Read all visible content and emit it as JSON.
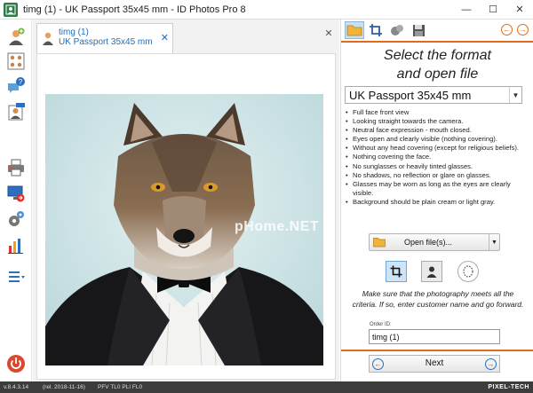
{
  "window": {
    "title": "timg (1) - UK Passport 35x45 mm - ID Photos Pro 8",
    "app_icon": "photo-id-icon",
    "controls": {
      "minimize": "—",
      "maximize": "☐",
      "close": "✕"
    }
  },
  "sidebar": {
    "items": [
      {
        "icon": "add-person-icon"
      },
      {
        "icon": "id-card-sheet-icon"
      },
      {
        "icon": "help-chat-icon"
      },
      {
        "icon": "new-id-photo-icon"
      },
      {
        "icon": "printer-icon"
      },
      {
        "icon": "export-screen-icon"
      },
      {
        "icon": "settings-gear-icon"
      },
      {
        "icon": "statistics-chart-icon"
      },
      {
        "icon": "menu-list-icon"
      },
      {
        "icon": "power-exit-icon"
      }
    ]
  },
  "document": {
    "tab": {
      "line1": "timg (1)",
      "line2": "UK Passport 35x45 mm",
      "close": "✕"
    },
    "close_all": "✕",
    "watermark": "pHome.NET"
  },
  "panel": {
    "toolbar": {
      "buttons": [
        "open-folder-icon",
        "crop-icon",
        "retouch-icon",
        "save-disk-icon"
      ],
      "prev": "←",
      "next": "→"
    },
    "heading_line1": "Select the format",
    "heading_line2": "and open file",
    "format": "UK Passport 35x45 mm",
    "criteria": [
      "Full face front view",
      "Looking straight towards the camera.",
      "Neutral face expression - mouth closed.",
      "Eyes open and clearly visible (nothing covering).",
      "Without any head covering (except for religious beliefs).",
      "Nothing covering the face.",
      "No sunglasses or heavily tinted glasses.",
      "No shadows, no reflection or glare on glasses.",
      "Glasses may be worn as long as the eyes are clearly visible.",
      "Background should be plain cream or light gray."
    ],
    "open_button": "Open file(s)...",
    "modes": [
      "crop-mode-icon",
      "person-mode-icon",
      "oval-mode-icon"
    ],
    "note": "Make sure that the photography meets all the criteria. If so, enter customer name and go forward.",
    "order_label": "Order ID:",
    "order_value": "timg (1)",
    "next_button": "Next",
    "accent_color": "#e06b1d"
  },
  "status": {
    "version": "v.8.4.3.14",
    "rel": "(rel. 2018-11-16)",
    "flags": "PFV  TL0  PLI  FL0",
    "brand": "PIXEL-TECH"
  }
}
